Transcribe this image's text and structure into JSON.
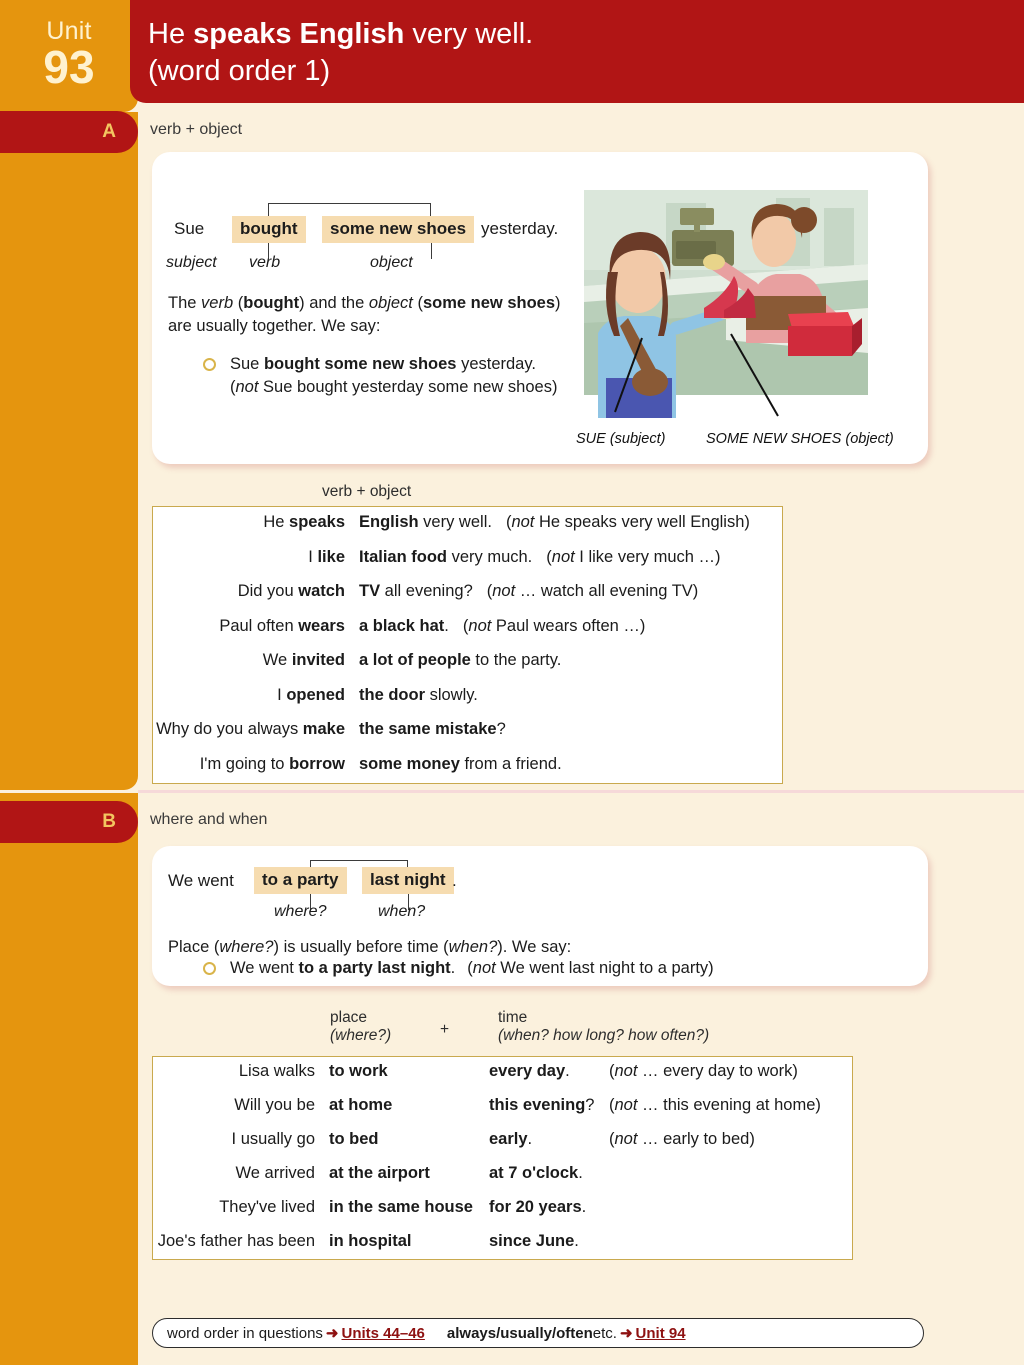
{
  "header": {
    "unit_word": "Unit",
    "unit_number": "93",
    "title_line1_a": "He ",
    "title_line1_b": "speaks English",
    "title_line1_c": " very well.",
    "title_line2": "(word order 1)",
    "colors": {
      "red": "#B11515",
      "orange": "#E5950E",
      "cream": "#FBF1DD",
      "gold": "#C9A94E",
      "highlight": "#F6DCB0"
    }
  },
  "section_a": {
    "letter": "A",
    "heading": "verb + object",
    "diagram": {
      "subject_word": "Sue",
      "verb_word": "bought",
      "object_word": "some new shoes",
      "tail_word": "yesterday.",
      "label_subject": "subject",
      "label_verb": "verb",
      "label_object": "object"
    },
    "explain_line1_a": "The ",
    "explain_line1_verb": "verb",
    "explain_line1_b": " (",
    "explain_line1_bought": "bought",
    "explain_line1_c": ") and the ",
    "explain_line1_object": "object",
    "explain_line1_d": " (",
    "explain_line1_shoes": "some new shoes",
    "explain_line1_e": ")",
    "explain_line2": "are usually together.  We say:",
    "bullet_main_a": "Sue ",
    "bullet_main_b": "bought some new shoes",
    "bullet_main_c": " yesterday.",
    "bullet_not_a": "(",
    "bullet_not_italic": "not",
    "bullet_not_b": " Sue bought yesterday some new shoes)",
    "caption_subject": "SUE (subject)",
    "caption_object": "SOME NEW SHOES (object)",
    "table_header": "verb + object",
    "rows": [
      {
        "left_plain": "He ",
        "left_bold": "speaks",
        "obj_bold": "English",
        "obj_rest": " very well.",
        "note_pre": "(",
        "note_it": "not",
        "note_rest": " He speaks very well English)"
      },
      {
        "left_plain": "I ",
        "left_bold": "like",
        "obj_bold": "Italian food",
        "obj_rest": " very much.",
        "note_pre": "(",
        "note_it": "not",
        "note_rest": " I like very much …)"
      },
      {
        "left_plain": "Did you ",
        "left_bold": "watch",
        "obj_bold": "TV",
        "obj_rest": " all evening?",
        "note_pre": "(",
        "note_it": "not",
        "note_rest": " … watch all evening TV)"
      },
      {
        "left_plain": "Paul often ",
        "left_bold": "wears",
        "obj_bold": "a black hat",
        "obj_rest": ".",
        "note_pre": "(",
        "note_it": "not",
        "note_rest": " Paul wears often …)"
      },
      {
        "left_plain": "We ",
        "left_bold": "invited",
        "obj_bold": "a lot of people",
        "obj_rest": " to the party.",
        "note_pre": "",
        "note_it": "",
        "note_rest": ""
      },
      {
        "left_plain": "I ",
        "left_bold": "opened",
        "obj_bold": "the door",
        "obj_rest": " slowly.",
        "note_pre": "",
        "note_it": "",
        "note_rest": ""
      },
      {
        "left_plain": "Why do you always ",
        "left_bold": "make",
        "obj_bold": "the same mistake",
        "obj_rest": "?",
        "note_pre": "",
        "note_it": "",
        "note_rest": ""
      },
      {
        "left_plain": "I'm going to ",
        "left_bold": "borrow",
        "obj_bold": "some money",
        "obj_rest": " from a friend.",
        "note_pre": "",
        "note_it": "",
        "note_rest": ""
      }
    ]
  },
  "section_b": {
    "letter": "B",
    "heading": "where and when",
    "diagram": {
      "lead_word": "We went",
      "place_word": "to a party",
      "time_word": "last night",
      "period": ".",
      "label_where": "where?",
      "label_when": "when?"
    },
    "explain_a": "Place (",
    "explain_where": "where?",
    "explain_b": ") is usually before time (",
    "explain_when": "when?",
    "explain_c": ").  We say:",
    "bullet_main_a": "We went ",
    "bullet_main_b": "to a party last night",
    "bullet_main_c": ".",
    "bullet_not_a": "(",
    "bullet_not_italic": "not",
    "bullet_not_b": " We went last night to a party)",
    "col_place_1": "place",
    "col_place_2": "(where?)",
    "col_plus": "+",
    "col_time_1": "time",
    "col_time_2": "(when? how long? how often?)",
    "rows": [
      {
        "left": "Lisa walks",
        "place": "to work",
        "time_bold": "every day",
        "time_rest": ".",
        "note_pre": "(",
        "note_it": "not",
        "note_rest": " … every day to work)"
      },
      {
        "left": "Will you be",
        "place": "at home",
        "time_bold": "this evening",
        "time_rest": "?",
        "note_pre": "(",
        "note_it": "not",
        "note_rest": " … this evening at home)"
      },
      {
        "left": "I usually go",
        "place": "to bed",
        "time_bold": "early",
        "time_rest": ".",
        "note_pre": "(",
        "note_it": "not",
        "note_rest": " …  early to bed)"
      },
      {
        "left": "We arrived",
        "place": "at the airport",
        "time_bold": "at 7 o'clock",
        "time_rest": ".",
        "note_pre": "",
        "note_it": "",
        "note_rest": ""
      },
      {
        "left": "They've lived",
        "place": "in the same house",
        "time_bold": "for 20 years",
        "time_rest": ".",
        "note_pre": "",
        "note_it": "",
        "note_rest": ""
      },
      {
        "left": "Joe's father has been",
        "place": "in hospital",
        "time_bold": "since June",
        "time_rest": ".",
        "note_pre": "",
        "note_it": "",
        "note_rest": ""
      }
    ]
  },
  "footer": {
    "text1": "word order in questions",
    "arrow1": "➜",
    "link1": "Units 44–46",
    "text2": "always/usually/often",
    "text3": " etc.",
    "arrow2": "➜",
    "link2": "Unit 94"
  }
}
